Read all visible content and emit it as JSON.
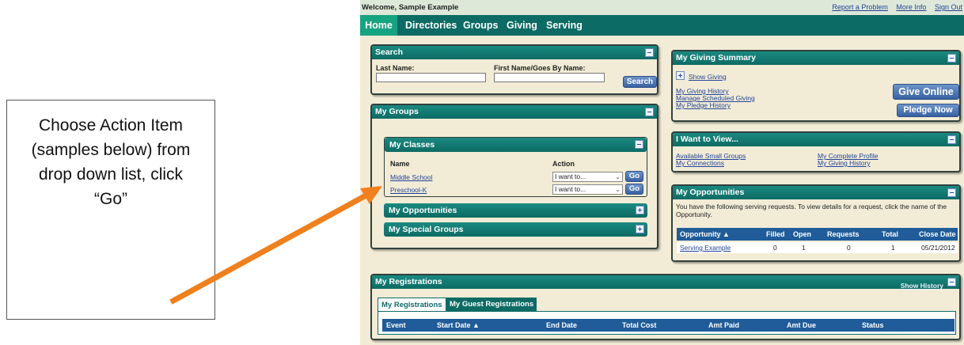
{
  "callout": {
    "text": "Choose Action Item (samples below) from drop down list, click “Go”"
  },
  "header": {
    "welcome": "Welcome, Sample Example",
    "links": [
      "Report a Problem",
      "More Info",
      "Sign Out"
    ]
  },
  "nav": {
    "items": [
      "Home",
      "Directories",
      "Groups",
      "Giving",
      "Serving"
    ]
  },
  "search": {
    "title": "Search",
    "last_name_label": "Last Name:",
    "first_name_label": "First Name/Goes By Name:",
    "last_name_value": "",
    "first_name_value": "",
    "button": "Search"
  },
  "my_groups": {
    "title": "My Groups",
    "classes": {
      "title": "My Classes",
      "col_name": "Name",
      "col_action": "Action",
      "rows": [
        {
          "name": "Middle School",
          "action": "I want to...",
          "go": "Go"
        },
        {
          "name": "Preschool-K",
          "action": "I want to...",
          "go": "Go"
        }
      ]
    },
    "opportunities_title": "My Opportunities",
    "special_groups_title": "My Special Groups"
  },
  "giving": {
    "title": "My Giving Summary",
    "show_giving": "Show Giving",
    "links": [
      "My Giving History",
      "Manage Scheduled Giving",
      "My Pledge History"
    ],
    "give_online": "Give Online",
    "pledge_now": "Pledge Now"
  },
  "want_to_view": {
    "title": "I Want to View...",
    "links_left": [
      "Available Small Groups",
      "My Connections"
    ],
    "links_right": [
      "My Complete Profile",
      "My Giving History"
    ]
  },
  "opportunities": {
    "title": "My Opportunities",
    "message": "You have the following serving requests. To view details for a request, click the name of the Opportunity.",
    "columns": [
      "Opportunity ▲",
      "Filled",
      "Open",
      "Requests",
      "Total",
      "Close Date"
    ],
    "rows": [
      {
        "opportunity": "Serving Example",
        "filled": "0",
        "open": "1",
        "requests": "0",
        "total": "1",
        "close_date": "05/21/2012"
      }
    ]
  },
  "registrations": {
    "title": "My Registrations",
    "show_history": "Show History",
    "tabs": [
      "My Registrations",
      "My Guest Registrations"
    ],
    "columns": [
      "Event",
      "Start Date ▲",
      "End Date",
      "Total Cost",
      "Amt Paid",
      "Amt Due",
      "Status"
    ]
  },
  "colors": {
    "teal": "#0c6b64",
    "accent": "#16a37f",
    "arrow": "#f07f1c",
    "table_head": "#1f5c99"
  }
}
